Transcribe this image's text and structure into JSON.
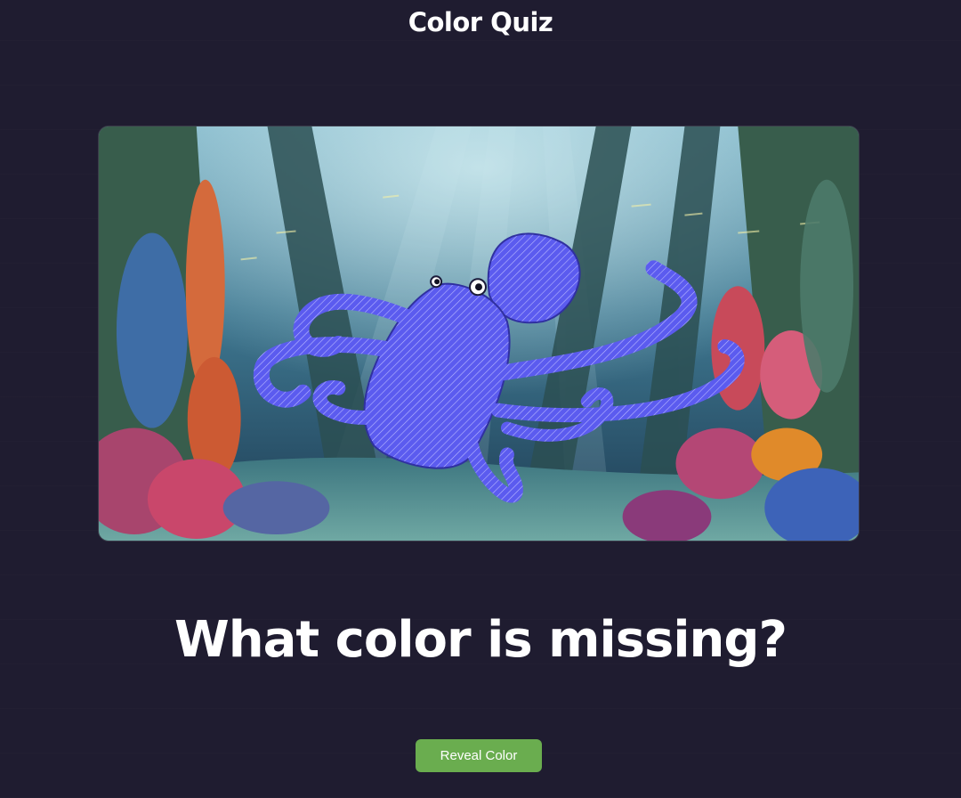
{
  "header": {
    "title": "Color Quiz"
  },
  "quiz": {
    "question": "What color is missing?",
    "reveal_label": "Reveal Color"
  },
  "colors": {
    "background": "#1f1c30",
    "button": "#6aad4f",
    "highlight": "#5b5bef"
  }
}
